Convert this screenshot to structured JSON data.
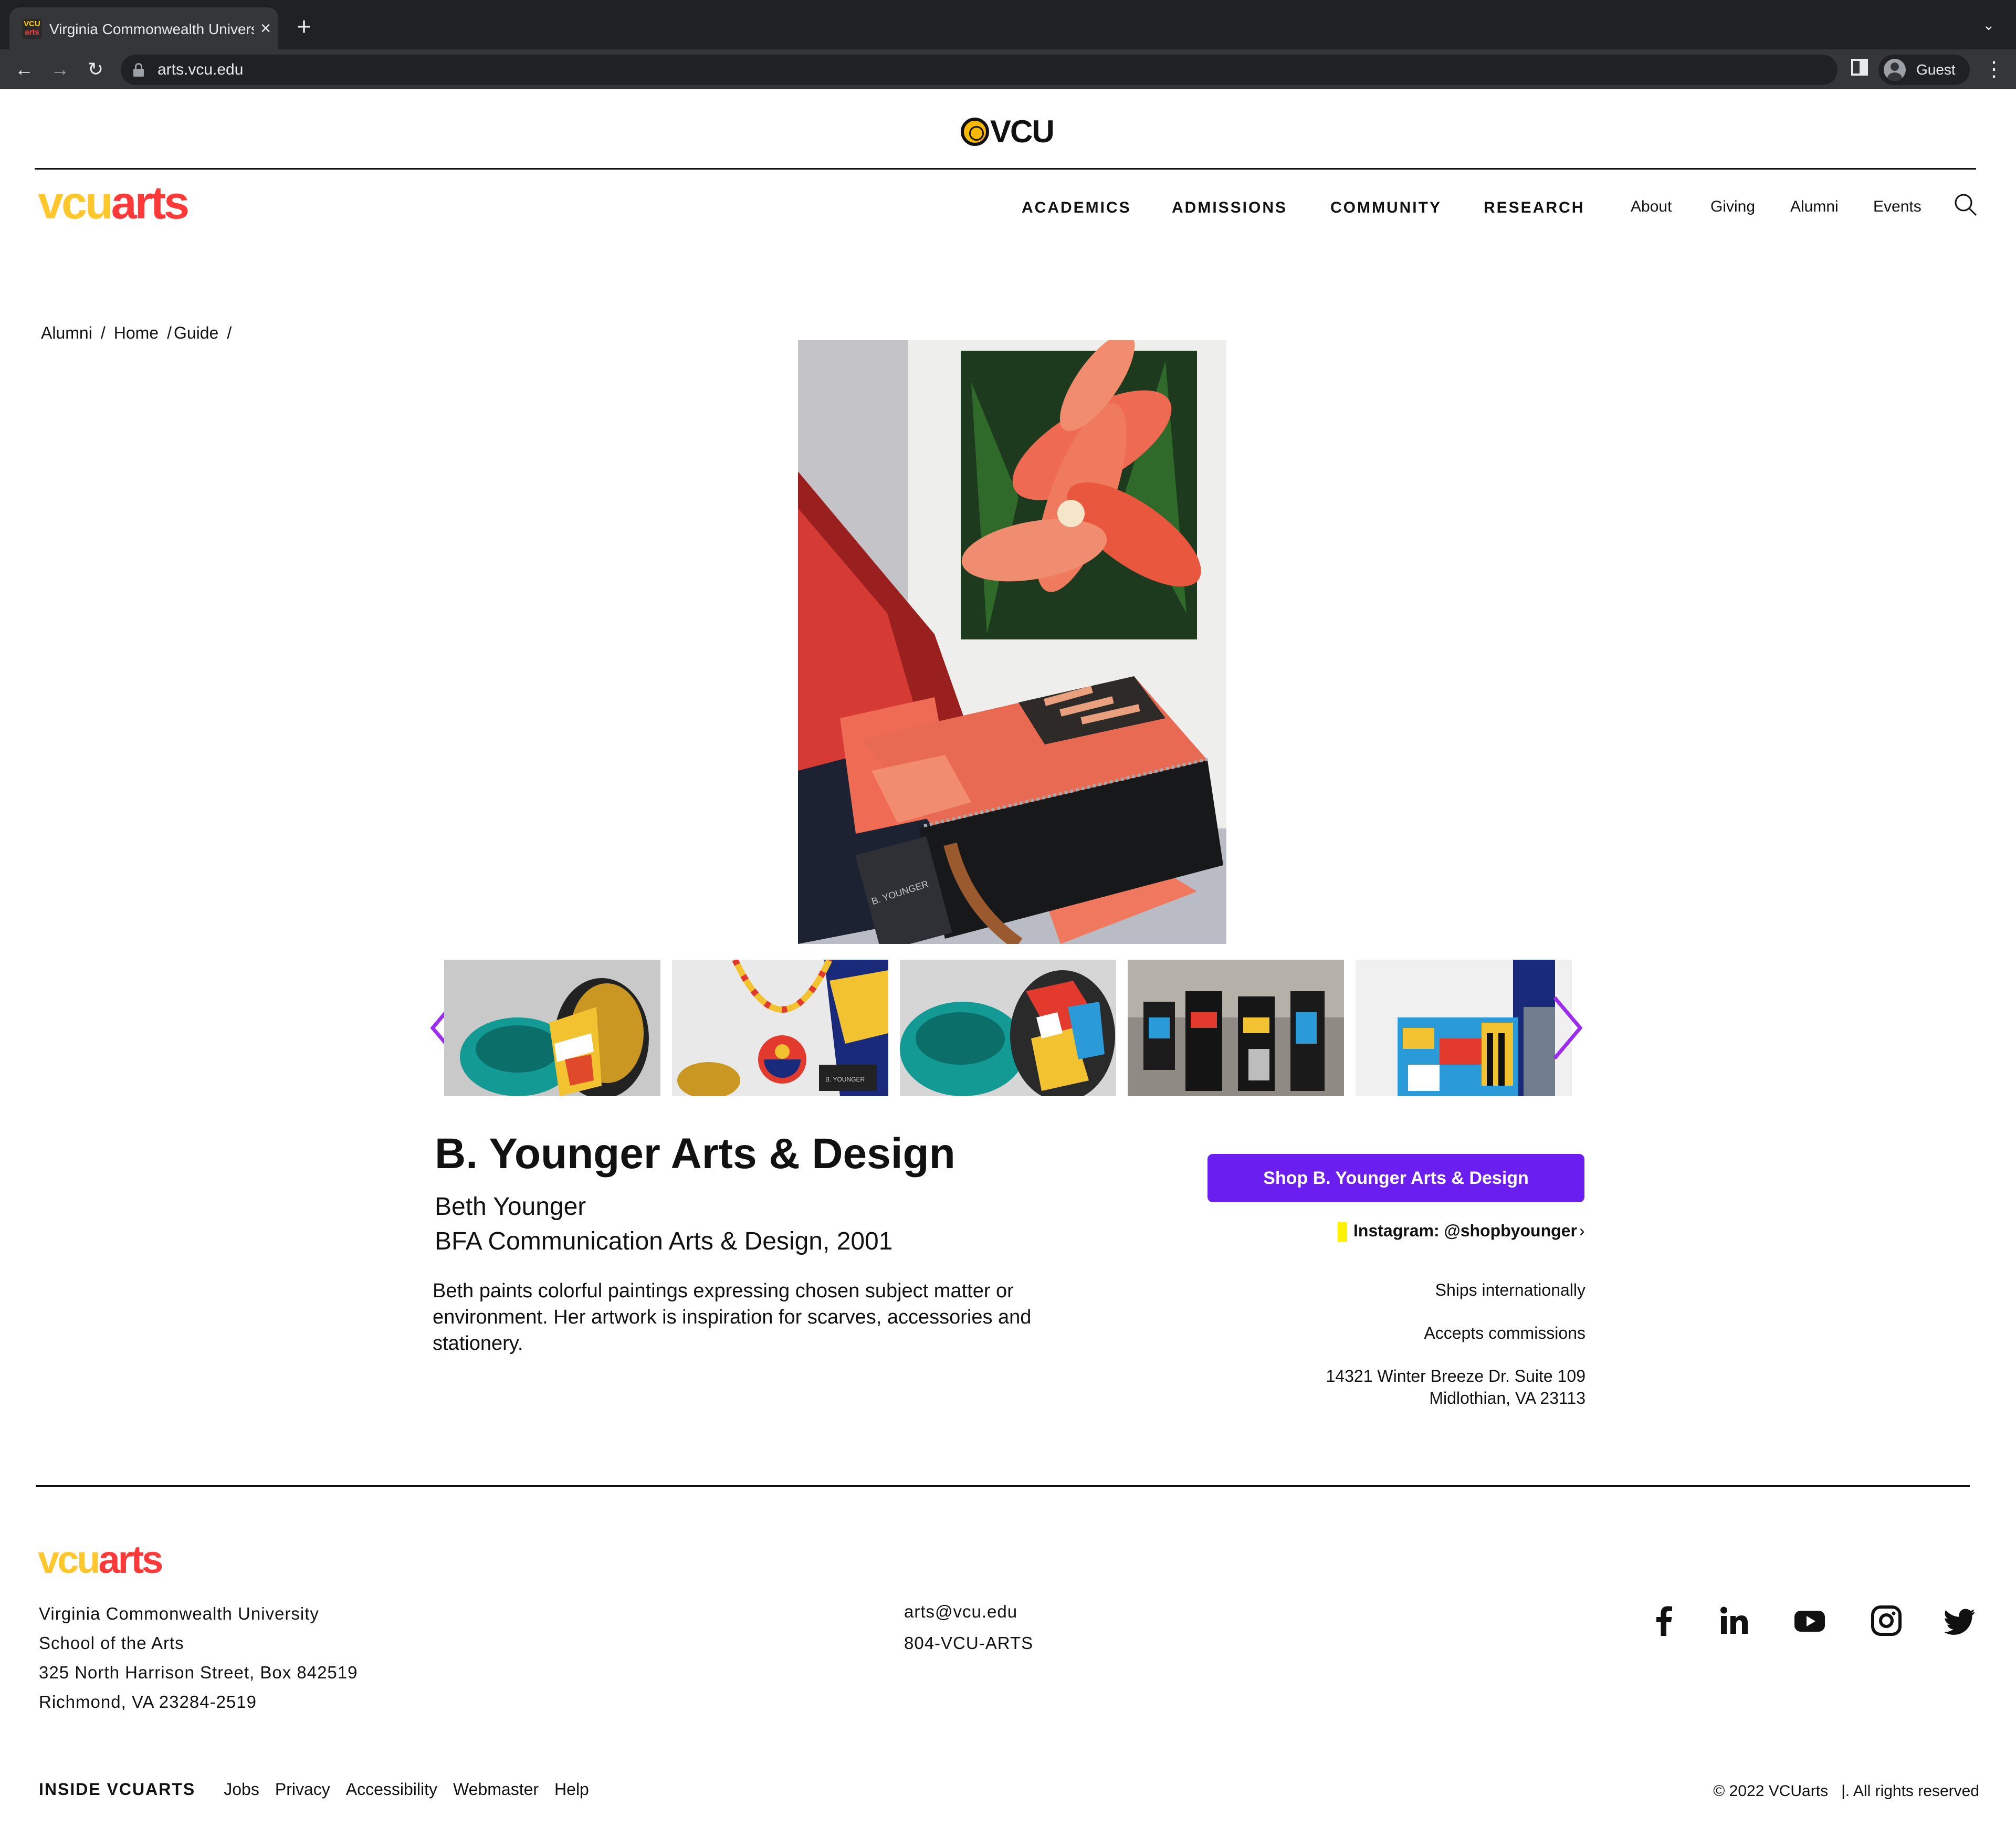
{
  "browser": {
    "tab_title": "Virginia Commonwealth University",
    "favicon_top": "VCU",
    "favicon_bottom": "arts",
    "url": "arts.vcu.edu",
    "profile_label": "Guest",
    "icons": [
      "back-icon",
      "forward-icon",
      "reload-icon",
      "lock-icon",
      "side-panel-icon",
      "avatar-icon",
      "kebab-menu-icon",
      "close-icon",
      "plus-icon"
    ]
  },
  "header": {
    "vcu_logo": "VCU",
    "brand_part1": "vcu",
    "brand_part2": "arts",
    "main_nav": [
      "ACADEMICS",
      "ADMISSIONS",
      "COMMUNITY",
      "RESEARCH"
    ],
    "util_nav": [
      "About",
      "Giving",
      "Alumni",
      "Events"
    ]
  },
  "breadcrumb": [
    "Alumni",
    "Home",
    "Guide"
  ],
  "gallery": {
    "hero_tag": "B. YOUNGER",
    "thumb_tag": "B. YOUNGER"
  },
  "details": {
    "title": "B. Younger Arts & Design",
    "person": "Beth Younger",
    "degree": "BFA Communication Arts & Design, 2001",
    "description": "Beth paints colorful paintings expressing chosen subject matter or environment. Her artwork is inspiration for scarves, accessories and stationery.",
    "shop_button": "Shop B. Younger Arts & Design",
    "instagram": "Instagram: @shopbyounger",
    "ships": "Ships internationally",
    "commissions": "Accepts commissions",
    "address_line1": "14321 Winter Breeze Dr. Suite 109",
    "address_line2": "Midlothian, VA 23113"
  },
  "footer": {
    "brand_part1": "vcu",
    "brand_part2": "arts",
    "address": [
      "Virginia Commonwealth University",
      "School of the Arts",
      "325 North Harrison Street, Box 842519",
      "Richmond, VA 23284-2519"
    ],
    "email": "arts@vcu.edu",
    "phone": "804-VCU-ARTS",
    "inside_label": "INSIDE VCUARTS",
    "links": [
      "Jobs",
      "Privacy",
      "Accessibility",
      "Webmaster",
      "Help"
    ],
    "copyright": "© 2022 VCUarts",
    "rights": "|.  All rights reserved"
  },
  "colors": {
    "brand_yellow": "#ffc72c",
    "brand_red": "#ff3838",
    "button_purple": "#6a1ef0",
    "arrow_purple": "#9b2cf0",
    "instagram_mark": "#fff200"
  }
}
